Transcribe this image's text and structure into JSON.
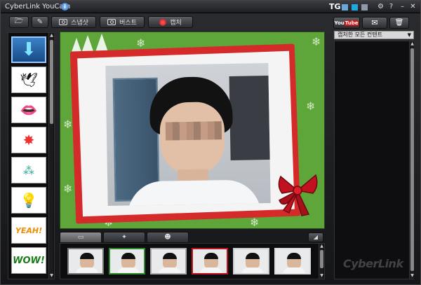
{
  "window": {
    "title": "CyberLink YouCam"
  },
  "title_bar": {
    "tg": "TG"
  },
  "toolbar": {
    "snapshot_label": "스냅샷",
    "burst_label": "버스트",
    "record_label": "캡처"
  },
  "right_panel": {
    "youtube_label_a": "You",
    "youtube_label_b": "Tube",
    "filter_selected": "캡처한 모든 컨텐트"
  },
  "brand_watermark": "CyberLink",
  "colors": {
    "accent_green": "#5ea53a",
    "frame_red": "#d42a2a",
    "record_red": "#cc0000"
  }
}
